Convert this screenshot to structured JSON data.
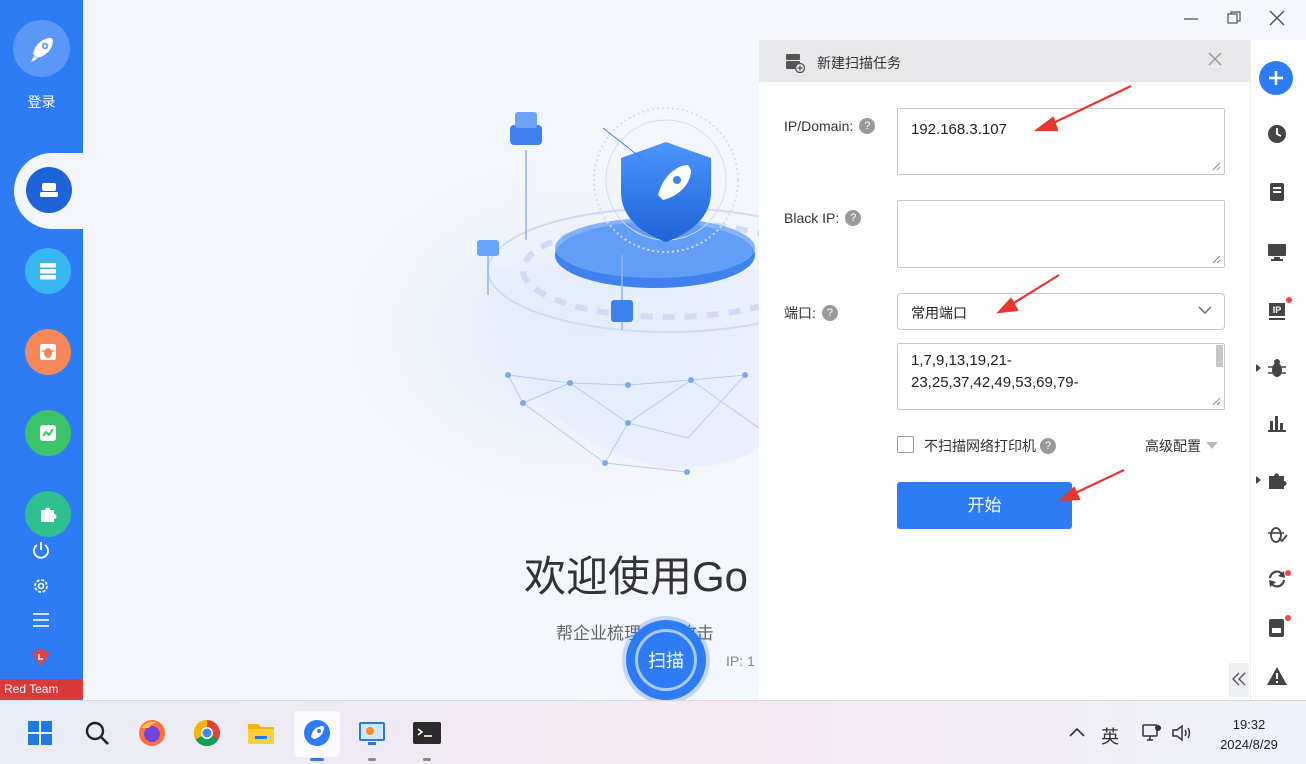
{
  "sidebar": {
    "login_label": "登录",
    "brand_label": "Red Team"
  },
  "main": {
    "welcome_text": "欢迎使用Go",
    "subtitle": "帮企业梳理    暴露攻击",
    "ip_label": "IP:  1",
    "scan_button": "扫描"
  },
  "dialog": {
    "title": "新建扫描任务",
    "ip_domain_label": "IP/Domain:",
    "ip_domain_value": "192.168.3.107",
    "black_ip_label": "Black IP:",
    "black_ip_value": "",
    "port_label": "端口:",
    "port_select_value": "常用端口",
    "port_list_line1": "1,7,9,13,19,21-",
    "port_list_line2": "23,25,37,42,49,53,69,79-",
    "no_printer_label": "不扫描网络打印机",
    "no_printer_checked": false,
    "advanced_label": "高级配置",
    "start_button": "开始"
  },
  "taskbar": {
    "tray_caret": "^",
    "ime": "英",
    "time": "19:32",
    "date": "2024/8/29"
  },
  "colors": {
    "accent": "#2e7bf6",
    "sidebar": "#2e7bf6",
    "annotation_arrow": "#e8372c"
  }
}
